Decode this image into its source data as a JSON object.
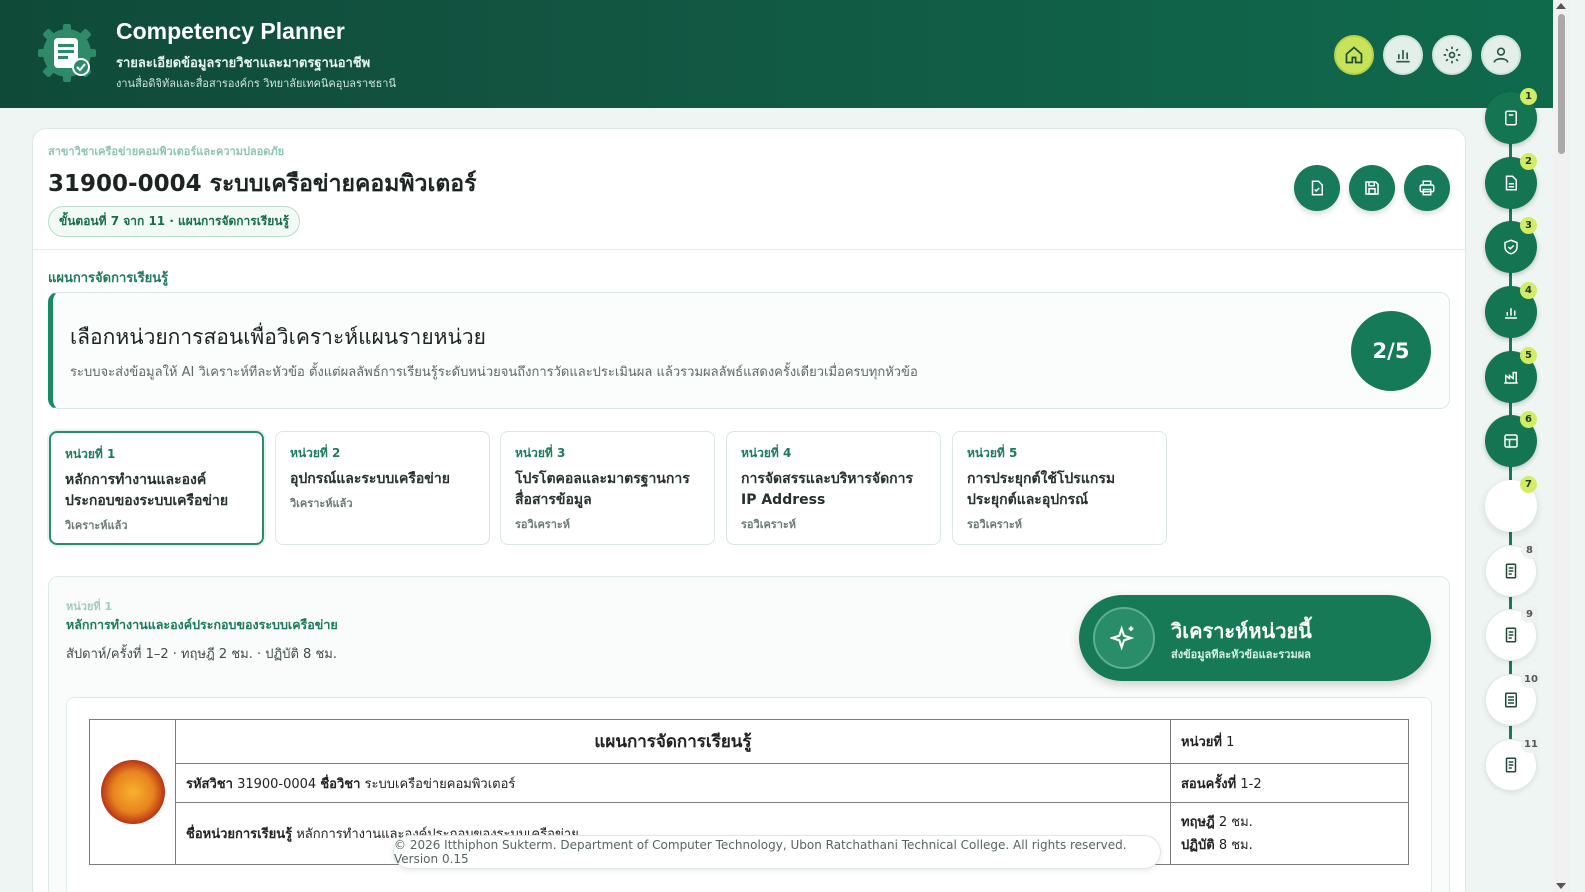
{
  "app": {
    "title": "Competency Planner",
    "subtitle": "รายละเอียดข้อมูลรายวิชาและมาตรฐานอาชีพ",
    "organization": "งานสื่อดิจิทัลและสื่อสารองค์กร วิทยาลัยเทคนิคอุบลราชธานี"
  },
  "header_buttons": [
    {
      "name": "home-icon",
      "active": true
    },
    {
      "name": "chart-icon",
      "active": false
    },
    {
      "name": "gear-icon",
      "active": false
    },
    {
      "name": "user-icon",
      "active": false
    }
  ],
  "course": {
    "department": "สาขาวิชาเครือข่ายคอมพิวเตอร์และความปลอดภัย",
    "title": "31900-0004 ระบบเครือข่ายคอมพิวเตอร์",
    "step_badge": "ขั้นตอนที่ 7 จาก 11 · แผนการจัดการเรียนรู้"
  },
  "section_label": "แผนการจัดการเรียนรู้",
  "analysis": {
    "title": "เลือกหน่วยการสอนเพื่อวิเคราะห์แผนรายหน่วย",
    "description": "ระบบจะส่งข้อมูลให้ AI วิเคราะห์ทีละหัวข้อ ตั้งแต่ผลลัพธ์การเรียนรู้ระดับหน่วยจนถึงการวัดและประเมินผล แล้วรวมผลลัพธ์แสดงครั้งเดียวเมื่อครบทุกหัวข้อ",
    "progress": "2/5"
  },
  "units": [
    {
      "label": "หน่วยที่ 1",
      "name": "หลักการทำงานและองค์ประกอบของระบบเครือข่าย",
      "status": "วิเคราะห์แล้ว",
      "selected": true
    },
    {
      "label": "หน่วยที่ 2",
      "name": "อุปกรณ์และระบบเครือข่าย",
      "status": "วิเคราะห์แล้ว",
      "selected": false
    },
    {
      "label": "หน่วยที่ 3",
      "name": "โปรโตคอลและมาตรฐานการสื่อสารข้อมูล",
      "status": "รอวิเคราะห์",
      "selected": false
    },
    {
      "label": "หน่วยที่ 4",
      "name": "การจัดสรรและบริหารจัดการ IP Address",
      "status": "รอวิเคราะห์",
      "selected": false
    },
    {
      "label": "หน่วยที่ 5",
      "name": "การประยุกต์ใช้โปรแกรมประยุกต์และอุปกรณ์",
      "status": "รอวิเคราะห์",
      "selected": false
    }
  ],
  "detail": {
    "unit_label": "หน่วยที่ 1",
    "unit_name": "หลักการทำงานและองค์ประกอบของระบบเครือข่าย",
    "meta": "สัปดาห์/ครั้งที่ 1–2 · ทฤษฎี 2 ชม. · ปฏิบัติ 8 ชม.",
    "analyze_label": "วิเคราะห์หน่วยนี้",
    "analyze_sub": "ส่งข้อมูลทีละหัวข้อและรวมผล"
  },
  "plan_table": {
    "title": "แผนการจัดการเรียนรู้",
    "unit_key": "หน่วยที่",
    "unit_val": "1",
    "code_key": "รหัสวิชา",
    "code_val": "31900-0004",
    "name_key": "ชื่อวิชา",
    "name_val": "ระบบเครือข่ายคอมพิวเตอร์",
    "session_key": "สอนครั้งที่",
    "session_val": "1-2",
    "unitname_key": "ชื่อหน่วยการเรียนรู้",
    "unitname_val": "หลักการทำงานและองค์ประกอบของระบบเครือข่าย",
    "theory_key": "ทฤษฎี",
    "theory_val": "2 ชม.",
    "practice_key": "ปฏิบัติ",
    "practice_val": "8 ชม."
  },
  "footer": "© 2026 Itthiphon Sukterm. Department of Computer Technology, Ubon Ratchathani Technical College. All rights reserved. Version 0.15",
  "steps": [
    {
      "num": "1",
      "state": "done",
      "icon": "book-icon"
    },
    {
      "num": "2",
      "state": "done",
      "icon": "document-icon"
    },
    {
      "num": "3",
      "state": "done",
      "icon": "shield-check-icon"
    },
    {
      "num": "4",
      "state": "done",
      "icon": "bar-chart-icon"
    },
    {
      "num": "5",
      "state": "done",
      "icon": "factory-icon"
    },
    {
      "num": "6",
      "state": "done",
      "icon": "table-icon"
    },
    {
      "num": "7",
      "state": "current",
      "icon": ""
    },
    {
      "num": "8",
      "state": "todo",
      "icon": "document-icon"
    },
    {
      "num": "9",
      "state": "todo",
      "icon": "document-icon"
    },
    {
      "num": "10",
      "state": "todo",
      "icon": "list-document-icon"
    },
    {
      "num": "11",
      "state": "todo",
      "icon": "document-icon"
    }
  ],
  "colors": {
    "header": "#125642",
    "primary": "#177a57",
    "accent": "#c7e35a"
  }
}
